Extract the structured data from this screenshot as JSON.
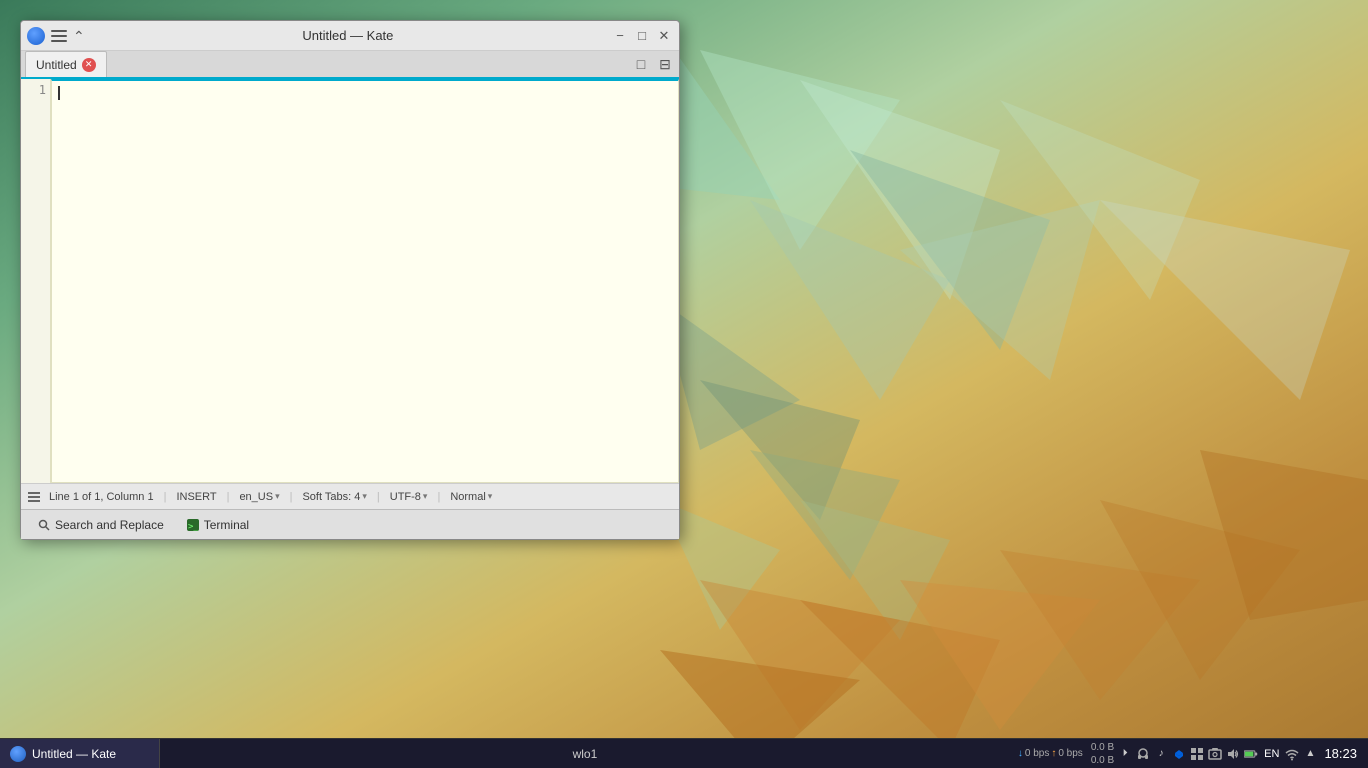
{
  "desktop": {
    "background": "colorful geometric"
  },
  "window": {
    "title": "Untitled — Kate",
    "tab_label": "Untitled",
    "logo_alt": "kate-logo"
  },
  "titlebar": {
    "title": "Untitled — Kate",
    "minimize_label": "−",
    "maximize_label": "□",
    "close_label": "✕",
    "chevron_up": "⌃"
  },
  "editor": {
    "line_number": "1",
    "content": ""
  },
  "statusbar": {
    "position": "Line 1 of 1, Column 1",
    "mode": "INSERT",
    "locale": "en_US",
    "indent": "Soft Tabs: 4",
    "encoding": "UTF-8",
    "highlight": "Normal"
  },
  "bottom_panel": {
    "tabs": [
      {
        "id": "search",
        "label": "Search and Replace",
        "icon": "search"
      },
      {
        "id": "terminal",
        "label": "Terminal",
        "icon": "terminal"
      }
    ]
  },
  "taskbar": {
    "app_label": "Untitled — Kate",
    "network_label": "wlo1",
    "speed_down": "0 bps",
    "speed_up": "0 bps",
    "data_down": "0.0 B",
    "data_up": "0.0 B",
    "locale": "EN",
    "time": "18:23"
  }
}
